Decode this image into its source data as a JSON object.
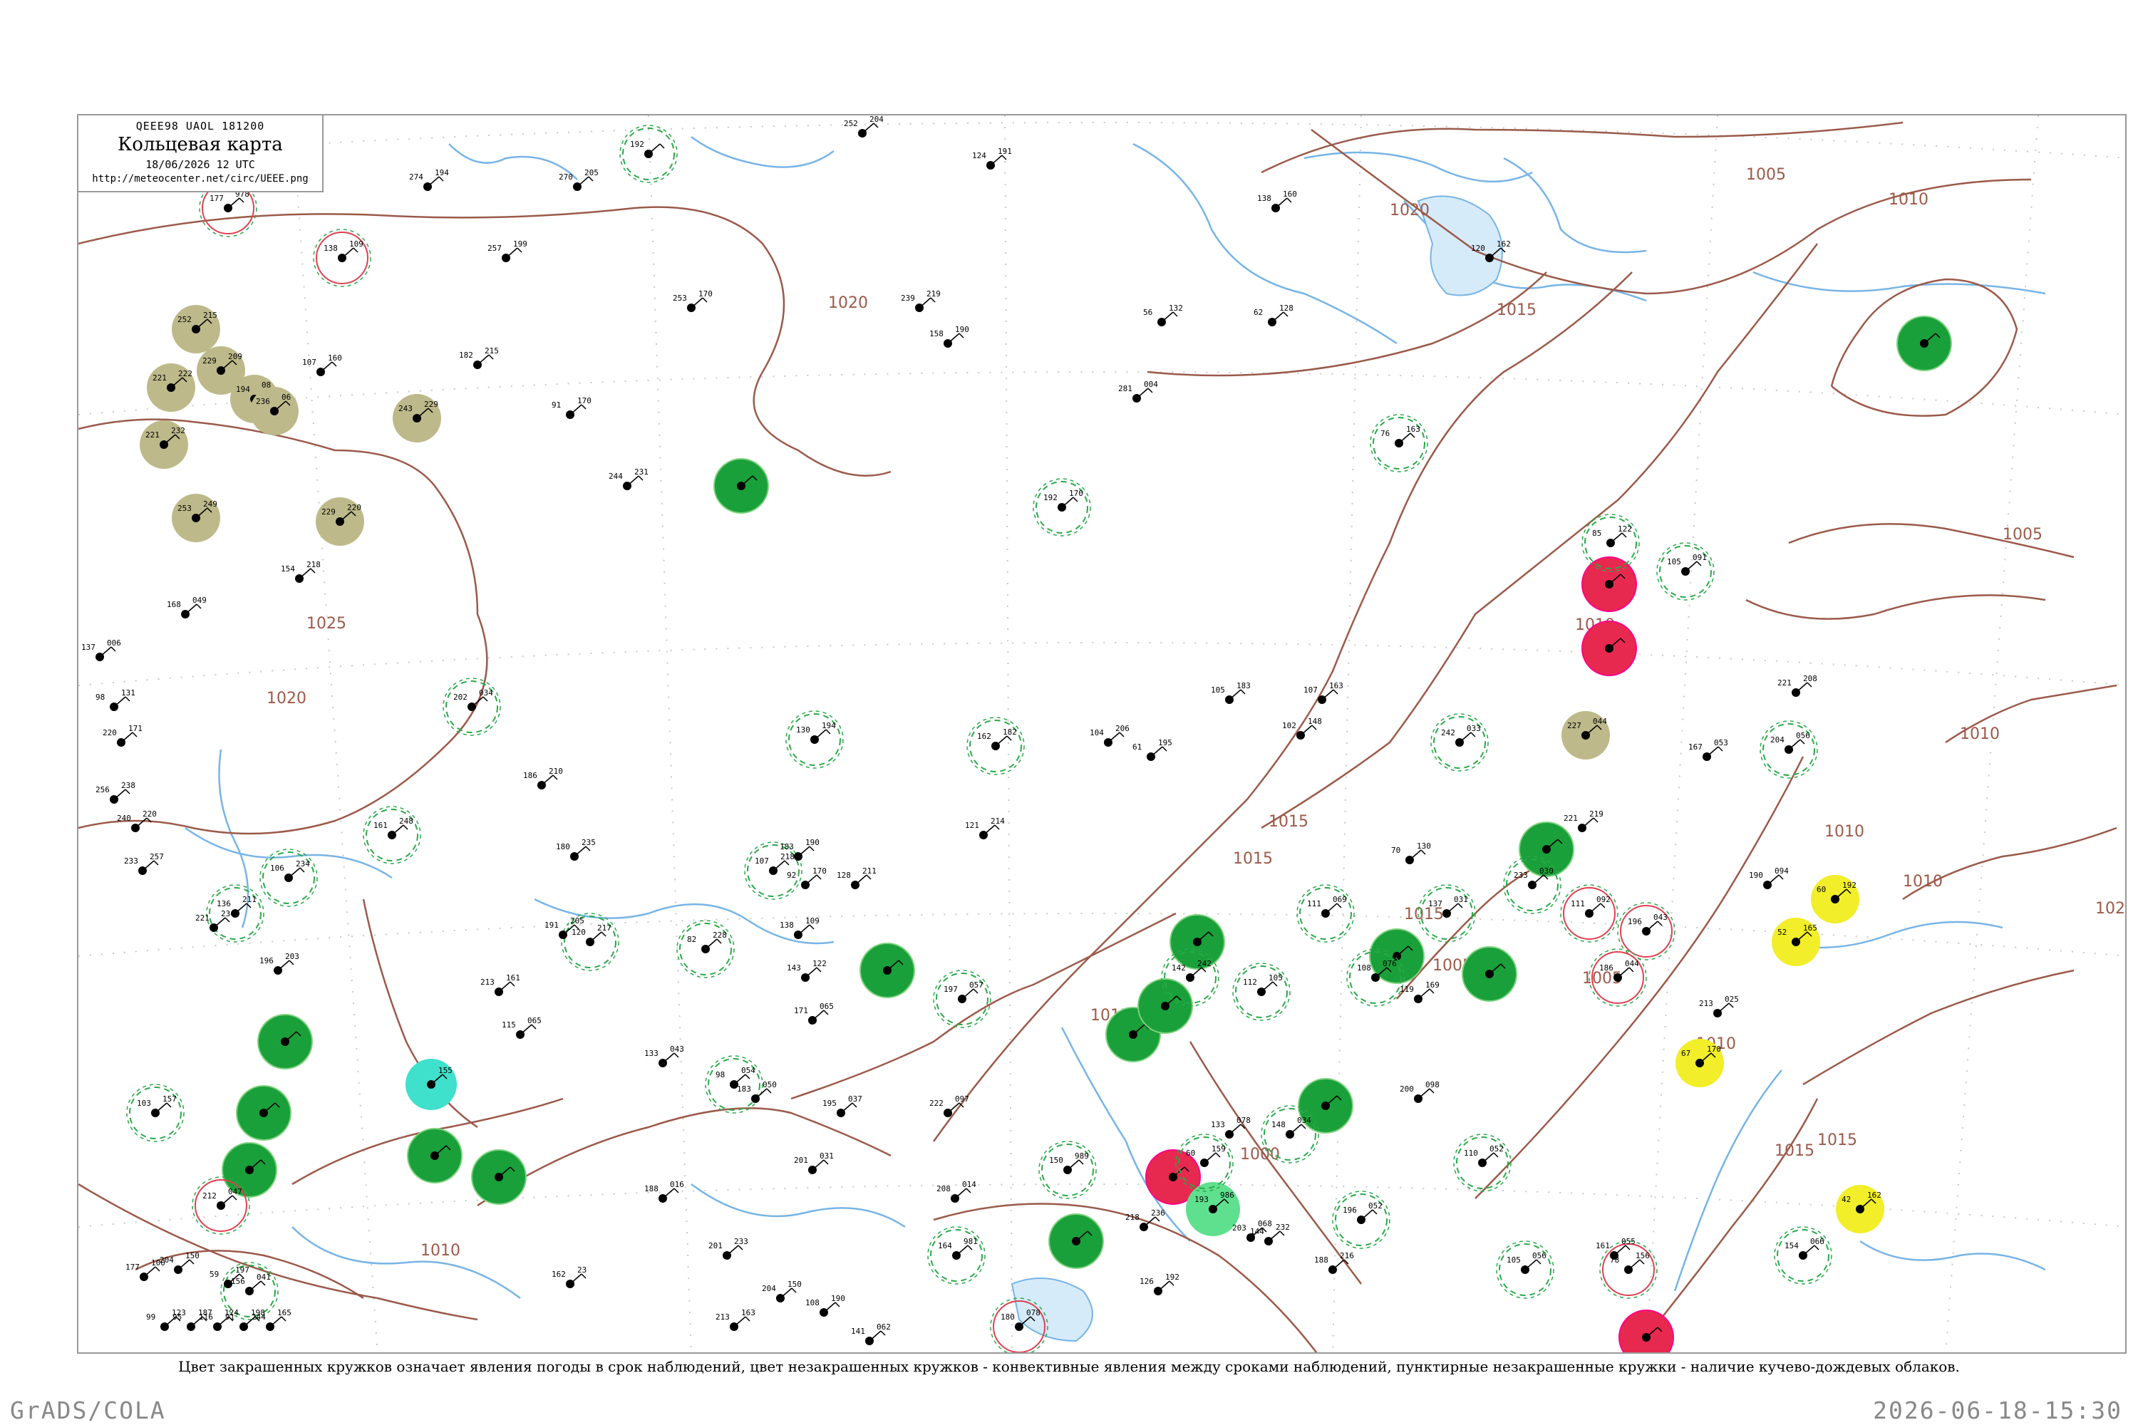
{
  "header": {
    "code_line": "QEEE98  UAOL  181200",
    "title": "Кольцевая карта",
    "date": "18/06/2026 12 UTC",
    "url": "http://meteocenter.net/circ/UEEE.png"
  },
  "caption": "Цвет закрашенных кружков означает явления погоды в срок наблюдений, цвет незакрашенных кружков - конвективные явления между сроками наблюдений, пунктирные незакрашенные кружки - наличие кучево-дождевых облаков.",
  "footer": {
    "left": "GrADS/COLA",
    "right": "2026-06-18-15:30"
  },
  "colors": {
    "isobar": "#9b5a4a",
    "river": "#78b4e6",
    "green_fill": "#1aa03a",
    "olive_fill": "#bdb98a",
    "red_fill": "#e8294f",
    "yellow_fill": "#f2ee2a",
    "cyan_fill": "#3fe0cc",
    "lightgreen_fill": "#5fe08e",
    "dashed_green": "#2aa84a",
    "red_ring": "#e04050"
  },
  "isobar_labels": [
    {
      "text": "1005"
    },
    {
      "text": "1010"
    },
    {
      "text": "1015"
    },
    {
      "text": "1020"
    },
    {
      "text": "1020"
    },
    {
      "text": "1025"
    },
    {
      "text": "1020"
    },
    {
      "text": "1010"
    },
    {
      "text": "1005"
    },
    {
      "text": "1010"
    },
    {
      "text": "1010"
    },
    {
      "text": "1015"
    },
    {
      "text": "1015"
    },
    {
      "text": "1020"
    },
    {
      "text": "1015"
    },
    {
      "text": "1005"
    },
    {
      "text": "1015"
    },
    {
      "text": "1015"
    },
    {
      "text": "1005"
    },
    {
      "text": "1000"
    },
    {
      "text": "1010"
    },
    {
      "text": "1010"
    },
    {
      "text": "1015"
    },
    {
      "text": "1010"
    }
  ],
  "stations": [
    {
      "style": "olive",
      "t": "252",
      "p": "215"
    },
    {
      "style": "olive",
      "t": "221",
      "p": "222"
    },
    {
      "style": "olive",
      "t": "229",
      "p": "209"
    },
    {
      "style": "olive",
      "t": "194",
      "p": "08"
    },
    {
      "style": "olive",
      "t": "236",
      "p": "06"
    },
    {
      "style": "olive",
      "t": "221",
      "p": "232"
    },
    {
      "style": "olive",
      "t": "243",
      "p": "229"
    },
    {
      "style": "olive",
      "t": "253",
      "p": "249"
    },
    {
      "style": "olive",
      "t": "229",
      "p": "220"
    },
    {
      "style": "olive",
      "t": "227",
      "p": "044"
    },
    {
      "style": "green",
      "t": "",
      "p": ""
    },
    {
      "style": "green",
      "t": "",
      "p": ""
    },
    {
      "style": "green",
      "t": "",
      "p": ""
    },
    {
      "style": "green",
      "t": "",
      "p": ""
    },
    {
      "style": "green",
      "t": "",
      "p": ""
    },
    {
      "style": "green",
      "t": "",
      "p": ""
    },
    {
      "style": "green",
      "t": "",
      "p": ""
    },
    {
      "style": "green",
      "t": "",
      "p": ""
    },
    {
      "style": "green",
      "t": "",
      "p": ""
    },
    {
      "style": "green",
      "t": "",
      "p": ""
    },
    {
      "style": "green",
      "t": "",
      "p": ""
    },
    {
      "style": "green",
      "t": "",
      "p": ""
    },
    {
      "style": "green",
      "t": "",
      "p": ""
    },
    {
      "style": "green",
      "t": "",
      "p": ""
    },
    {
      "style": "green",
      "t": "",
      "p": ""
    },
    {
      "style": "green",
      "t": "",
      "p": ""
    },
    {
      "style": "red",
      "t": "",
      "p": ""
    },
    {
      "style": "red",
      "t": "",
      "p": ""
    },
    {
      "style": "red",
      "t": "",
      "p": ""
    },
    {
      "style": "red",
      "t": "",
      "p": ""
    },
    {
      "style": "yellow",
      "t": "60",
      "p": "192"
    },
    {
      "style": "yellow",
      "t": "52",
      "p": "165"
    },
    {
      "style": "yellow",
      "t": "67",
      "p": "170"
    },
    {
      "style": "yellow",
      "t": "42",
      "p": "162"
    },
    {
      "style": "cyan",
      "t": "",
      "p": "155"
    },
    {
      "style": "lightgreen",
      "t": "193",
      "p": "986"
    },
    {
      "style": "dashed",
      "t": "192",
      "p": ""
    },
    {
      "style": "dashed",
      "t": "60",
      "p": "159"
    },
    {
      "style": "dashed",
      "t": "76",
      "p": "163"
    },
    {
      "style": "dashed",
      "t": "192",
      "p": "170"
    },
    {
      "style": "dashed",
      "t": "85",
      "p": "122"
    },
    {
      "style": "dashed",
      "t": "202",
      "p": "034"
    },
    {
      "style": "dashed",
      "t": "130",
      "p": "194"
    },
    {
      "style": "dashed",
      "t": "162",
      "p": "182"
    },
    {
      "style": "dashed",
      "t": "107",
      "p": "218"
    },
    {
      "style": "dashed",
      "t": "106",
      "p": "234"
    },
    {
      "style": "dashed",
      "t": "161",
      "p": "248"
    },
    {
      "style": "dashed",
      "t": "142",
      "p": "242"
    },
    {
      "style": "dashed",
      "t": "136",
      "p": "211"
    },
    {
      "style": "dashed",
      "t": "120",
      "p": "217"
    },
    {
      "style": "dashed",
      "t": "82",
      "p": "228"
    },
    {
      "style": "dashed",
      "t": "98",
      "p": "054"
    },
    {
      "style": "dashed",
      "t": "110",
      "p": "052"
    },
    {
      "style": "dashed",
      "t": "103",
      "p": "157"
    },
    {
      "style": "dashed",
      "t": "156",
      "p": "041"
    },
    {
      "style": "dashed",
      "t": "150",
      "p": "989"
    },
    {
      "style": "dashed",
      "t": "164",
      "p": "981"
    },
    {
      "style": "dashed",
      "t": "148",
      "p": "034"
    },
    {
      "style": "dashed",
      "t": "196",
      "p": "052"
    },
    {
      "style": "dashed",
      "t": "105",
      "p": "056"
    },
    {
      "style": "dashed",
      "t": "154",
      "p": "066"
    },
    {
      "style": "dashed",
      "t": "137",
      "p": "031"
    },
    {
      "style": "dashed",
      "t": "233",
      "p": "030"
    },
    {
      "style": "dashed",
      "t": "242",
      "p": "033"
    },
    {
      "style": "dashed",
      "t": "111",
      "p": "069"
    },
    {
      "style": "dashed",
      "t": "204",
      "p": "056"
    },
    {
      "style": "dashed",
      "t": "112",
      "p": "105"
    },
    {
      "style": "dashed",
      "t": "197",
      "p": "057"
    },
    {
      "style": "dashed",
      "t": "105",
      "p": "091"
    },
    {
      "style": "dashed",
      "t": "108",
      "p": "076"
    },
    {
      "style": "redring",
      "t": "111",
      "p": "092"
    },
    {
      "style": "redring",
      "t": "196",
      "p": "043"
    },
    {
      "style": "redring",
      "t": "186",
      "p": "044"
    },
    {
      "style": "redring",
      "t": "212",
      "p": "047"
    },
    {
      "style": "redring",
      "t": "180",
      "p": "078"
    },
    {
      "style": "redring",
      "t": "78",
      "p": "156"
    },
    {
      "style": "redring",
      "t": "177",
      "p": "978"
    },
    {
      "style": "redring",
      "t": "138",
      "p": "109"
    },
    {
      "style": "plain",
      "t": "274",
      "p": "194"
    },
    {
      "style": "plain",
      "t": "270",
      "p": "205"
    },
    {
      "style": "plain",
      "t": "257",
      "p": "199"
    },
    {
      "style": "plain",
      "t": "253",
      "p": "170"
    },
    {
      "style": "plain",
      "t": "252",
      "p": "204"
    },
    {
      "style": "plain",
      "t": "124",
      "p": "191"
    },
    {
      "style": "plain",
      "t": "138",
      "p": "160"
    },
    {
      "style": "plain",
      "t": "120",
      "p": "162"
    },
    {
      "style": "plain",
      "t": "62",
      "p": "128"
    },
    {
      "style": "plain",
      "t": "56",
      "p": "132"
    },
    {
      "style": "plain",
      "t": "281",
      "p": "004"
    },
    {
      "style": "plain",
      "t": "91",
      "p": "170"
    },
    {
      "style": "plain",
      "t": "107",
      "p": "160"
    },
    {
      "style": "plain",
      "t": "182",
      "p": "215"
    },
    {
      "style": "plain",
      "t": "239",
      "p": "219"
    },
    {
      "style": "plain",
      "t": "244",
      "p": "231"
    },
    {
      "style": "plain",
      "t": "154",
      "p": "218"
    },
    {
      "style": "plain",
      "t": "158",
      "p": "190"
    },
    {
      "style": "plain",
      "t": "221",
      "p": "208"
    },
    {
      "style": "plain",
      "t": "221",
      "p": "219"
    },
    {
      "style": "plain",
      "t": "167",
      "p": "053"
    },
    {
      "style": "plain",
      "t": "190",
      "p": "094"
    },
    {
      "style": "plain",
      "t": "213",
      "p": "025"
    },
    {
      "style": "plain",
      "t": "119",
      "p": "169"
    },
    {
      "style": "plain",
      "t": "200",
      "p": "098"
    },
    {
      "style": "plain",
      "t": "203",
      "p": "068"
    },
    {
      "style": "plain",
      "t": "161",
      "p": "055"
    },
    {
      "style": "plain",
      "t": "133",
      "p": "078"
    },
    {
      "style": "plain",
      "t": "143",
      "p": "122"
    },
    {
      "style": "plain",
      "t": "195",
      "p": "037"
    },
    {
      "style": "plain",
      "t": "138",
      "p": "109"
    },
    {
      "style": "plain",
      "t": "92",
      "p": "170"
    },
    {
      "style": "plain",
      "t": "183",
      "p": "190"
    },
    {
      "style": "plain",
      "t": "128",
      "p": "211"
    },
    {
      "style": "plain",
      "t": "121",
      "p": "214"
    },
    {
      "style": "plain",
      "t": "104",
      "p": "206"
    },
    {
      "style": "plain",
      "t": "61",
      "p": "195"
    },
    {
      "style": "plain",
      "t": "105",
      "p": "183"
    },
    {
      "style": "plain",
      "t": "107",
      "p": "163"
    },
    {
      "style": "plain",
      "t": "102",
      "p": "148"
    },
    {
      "style": "plain",
      "t": "70",
      "p": "130"
    },
    {
      "style": "plain",
      "t": "186",
      "p": "210"
    },
    {
      "style": "plain",
      "t": "180",
      "p": "235"
    },
    {
      "style": "plain",
      "t": "191",
      "p": "205"
    },
    {
      "style": "plain",
      "t": "213",
      "p": "161"
    },
    {
      "style": "plain",
      "t": "204",
      "p": "150"
    },
    {
      "style": "plain",
      "t": "177",
      "p": "100"
    },
    {
      "style": "plain",
      "t": "59",
      "p": "197"
    },
    {
      "style": "plain",
      "t": "162",
      "p": "23"
    },
    {
      "style": "plain",
      "t": "168",
      "p": "049"
    },
    {
      "style": "plain",
      "t": "137",
      "p": "006"
    },
    {
      "style": "plain",
      "t": "98",
      "p": "131"
    },
    {
      "style": "plain",
      "t": "220",
      "p": "171"
    },
    {
      "style": "plain",
      "t": "256",
      "p": "238"
    },
    {
      "style": "plain",
      "t": "240",
      "p": "220"
    },
    {
      "style": "plain",
      "t": "233",
      "p": "257"
    },
    {
      "style": "plain",
      "t": "221",
      "p": "234"
    },
    {
      "style": "plain",
      "t": "196",
      "p": "203"
    },
    {
      "style": "plain",
      "t": "126",
      "p": "192"
    },
    {
      "style": "plain",
      "t": "144",
      "p": "232"
    },
    {
      "style": "plain",
      "t": "188",
      "p": "216"
    },
    {
      "style": "plain",
      "t": "218",
      "p": "236"
    },
    {
      "style": "plain",
      "t": "201",
      "p": "233"
    },
    {
      "style": "plain",
      "t": "213",
      "p": "163"
    },
    {
      "style": "plain",
      "t": "204",
      "p": "150"
    },
    {
      "style": "plain",
      "t": "108",
      "p": "190"
    },
    {
      "style": "plain",
      "t": "141",
      "p": "062"
    },
    {
      "style": "plain",
      "t": "208",
      "p": "014"
    },
    {
      "style": "plain",
      "t": "222",
      "p": "097"
    },
    {
      "style": "plain",
      "t": "201",
      "p": "031"
    },
    {
      "style": "plain",
      "t": "188",
      "p": "016"
    },
    {
      "style": "plain",
      "t": "183",
      "p": "050"
    },
    {
      "style": "plain",
      "t": "133",
      "p": "043"
    },
    {
      "style": "plain",
      "t": "171",
      "p": "065"
    },
    {
      "style": "plain",
      "t": "115",
      "p": "065"
    },
    {
      "style": "plain",
      "t": "99",
      "p": "123"
    },
    {
      "style": "plain",
      "t": "95",
      "p": "187"
    },
    {
      "style": "plain",
      "t": "116",
      "p": "124"
    },
    {
      "style": "plain",
      "t": "91",
      "p": "198"
    },
    {
      "style": "plain",
      "t": "244",
      "p": "165"
    }
  ]
}
